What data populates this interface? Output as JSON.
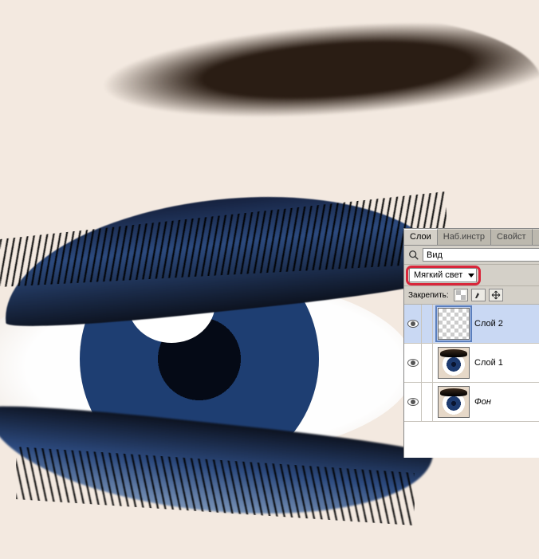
{
  "tabs": {
    "layers": "Слои",
    "tools": "Наб.инстр",
    "props": "Свойст"
  },
  "search": {
    "placeholder": "Вид"
  },
  "blend_mode": {
    "value": "Мягкий свет"
  },
  "lock": {
    "label": "Закрепить:"
  },
  "layers": [
    {
      "name": "Слой 2",
      "visible": true,
      "selected": true,
      "thumb": "transparent"
    },
    {
      "name": "Слой 1",
      "visible": true,
      "selected": false,
      "thumb": "eye"
    },
    {
      "name": "Фон",
      "visible": true,
      "selected": false,
      "thumb": "eye",
      "bg": true
    }
  ]
}
